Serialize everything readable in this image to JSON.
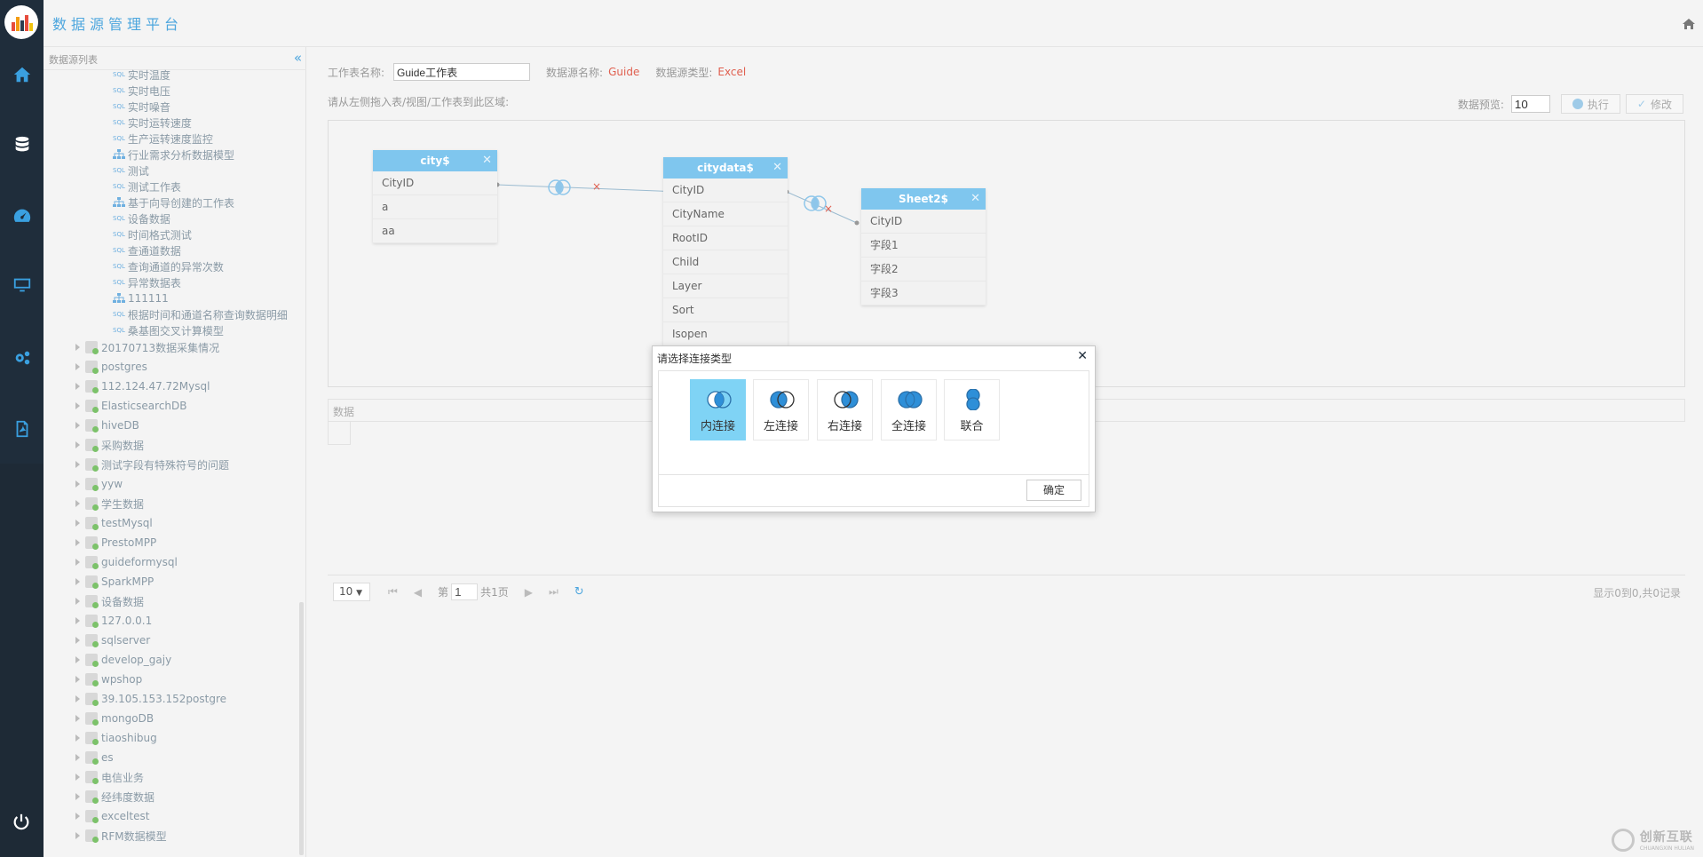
{
  "app": {
    "title": "数据源管理平台"
  },
  "nav": {
    "icons": [
      "home-icon",
      "database-icon",
      "dashboard-icon",
      "monitor-icon",
      "settings-icon",
      "pdf-icon",
      "power-icon"
    ]
  },
  "sidebar": {
    "title": "数据源列表",
    "items": [
      {
        "label": "实时温度",
        "kind": "sql"
      },
      {
        "label": "实时电压",
        "kind": "sql"
      },
      {
        "label": "实时噪音",
        "kind": "sql"
      },
      {
        "label": "实时运转速度",
        "kind": "sql"
      },
      {
        "label": "生产运转速度监控",
        "kind": "sql"
      },
      {
        "label": "行业需求分析数据模型",
        "kind": "model"
      },
      {
        "label": "测试",
        "kind": "sql"
      },
      {
        "label": "测试工作表",
        "kind": "sql"
      },
      {
        "label": "基于向导创建的工作表",
        "kind": "model"
      },
      {
        "label": "设备数据",
        "kind": "sql"
      },
      {
        "label": "时间格式测试",
        "kind": "sql"
      },
      {
        "label": "查通道数据",
        "kind": "sql"
      },
      {
        "label": "查询通道的异常次数",
        "kind": "sql"
      },
      {
        "label": "异常数据表",
        "kind": "sql"
      },
      {
        "label": "111111",
        "kind": "model"
      },
      {
        "label": "根据时间和通道名称查询数据明细",
        "kind": "sql"
      },
      {
        "label": "桑基图交叉计算模型",
        "kind": "sql"
      }
    ],
    "sources": [
      "20170713数据采集情况",
      "postgres",
      "112.124.47.72Mysql",
      "ElasticsearchDB",
      "hiveDB",
      "采购数据",
      "测试字段有特殊符号的问题",
      "yyw",
      "学生数据",
      "testMysql",
      "PrestoMPP",
      "guideformysql",
      "SparkMPP",
      "设备数据",
      "127.0.0.1",
      "sqlserver",
      "develop_gajy",
      "wpshop",
      "39.105.153.152postgre",
      "mongoDB",
      "tiaoshibug",
      "es",
      "电信业务",
      "经纬度数据",
      "exceltest",
      "RFM数据模型"
    ]
  },
  "form": {
    "sheet_name_label": "工作表名称:",
    "sheet_name_value": "Guide工作表",
    "source_name_label": "数据源名称:",
    "source_name_value": "Guide",
    "source_type_label": "数据源类型:",
    "source_type_value": "Excel",
    "hint": "请从左侧拖入表/视图/工作表到此区域:",
    "preview_label": "数据预览:",
    "preview_value": "10",
    "execute_label": "执行",
    "modify_label": "修改"
  },
  "tables": [
    {
      "name": "city$",
      "fields": [
        "CityID",
        "a",
        "aa"
      ]
    },
    {
      "name": "citydata$",
      "fields": [
        "CityID",
        "CityName",
        "RootID",
        "Child",
        "Layer",
        "Sort",
        "Isopen"
      ]
    },
    {
      "name": "Sheet2$",
      "fields": [
        "CityID",
        "字段1",
        "字段2",
        "字段3"
      ]
    }
  ],
  "data_panel": {
    "title": "数据"
  },
  "pager": {
    "page_size": "10",
    "page_prefix": "第",
    "page_value": "1",
    "page_suffix": "共1页",
    "summary": "显示0到0,共0记录"
  },
  "modal": {
    "title": "请选择连接类型",
    "options": [
      {
        "label": "内连接",
        "icon": "inner-join-icon",
        "active": true
      },
      {
        "label": "左连接",
        "icon": "left-join-icon",
        "active": false
      },
      {
        "label": "右连接",
        "icon": "right-join-icon",
        "active": false
      },
      {
        "label": "全连接",
        "icon": "full-join-icon",
        "active": false
      },
      {
        "label": "联合",
        "icon": "union-icon",
        "active": false
      }
    ],
    "confirm_label": "确定"
  },
  "watermark": {
    "text": "创新互联",
    "sub": "CHUANGXIN HULIAN"
  },
  "colors": {
    "accent": "#4da6de",
    "table_header": "#7fc6ee",
    "active_option": "#7fd3f5",
    "value_red": "#e06050",
    "nav_bg": "#1f2d3b"
  }
}
